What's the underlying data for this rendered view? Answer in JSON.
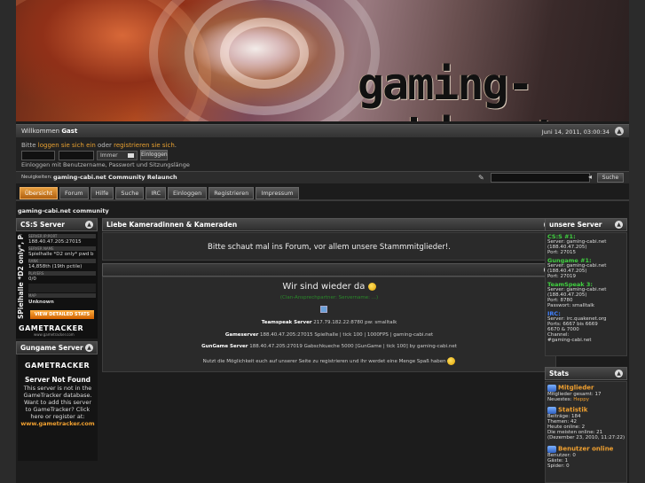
{
  "banner": {
    "logo_text": "gaming-cabi.net"
  },
  "header": {
    "greeting_prefix": "Willkommen",
    "greeting_user": "Gast",
    "datetime": "Juni 14, 2011, 03:00:34"
  },
  "login": {
    "prompt_before": "Bitte ",
    "login_link": "loggen sie sich ein",
    "prompt_mid": " oder ",
    "register_link": "registrieren sie sich",
    "prompt_after": ".",
    "remember_option": "Immer",
    "login_button": "Einloggen",
    "duration_hint": "Einloggen mit Benutzername, Passwort und Sitzungslänge"
  },
  "news": {
    "label": "Neuigkeiten:",
    "text": "gaming-cabi.net Community Relaunch",
    "search_button": "Suche"
  },
  "nav": {
    "tabs": [
      {
        "label": "Übersicht",
        "active": true
      },
      {
        "label": "Forum",
        "active": false
      },
      {
        "label": "Hilfe",
        "active": false
      },
      {
        "label": "Suche",
        "active": false
      },
      {
        "label": "IRC",
        "active": false
      },
      {
        "label": "Einloggen",
        "active": false
      },
      {
        "label": "Registrieren",
        "active": false
      },
      {
        "label": "Impressum",
        "active": false
      }
    ]
  },
  "breadcrumb": "gaming-cabi.net community",
  "left": {
    "css_title": "CS:S Server",
    "css_widget": {
      "vertical_text": "SPielhalle *D2 only*, Pu",
      "ip_header": "SERVER IP:PORT",
      "ip": "188.40.47.205:27015",
      "name_header": "SERVER NAME",
      "name": "Spielhalle *D2 only* pwd b",
      "rank_header": "RANK",
      "rank": "14,858th (19th pctile)",
      "players_header": "PLAYERS",
      "players": "0/0",
      "map_header": "MAP",
      "map": "Unknown",
      "button": "VIEW DETAILED STATS",
      "brand": "GAMETRACKER",
      "brand_url": "www.gametracker.com"
    },
    "gungame_title": "Gungame Server",
    "gungame_widget": {
      "brand": "GAMETRACKER",
      "not_found": "Server Not Found",
      "message": "This server is not in the GameTracker database. Want to add this server to GameTracker? Click here or register at:",
      "url": "www.gametracker.com"
    }
  },
  "center": {
    "panel1_title": "Liebe Kameradinnen & Kameraden",
    "panel1_text": "Bitte schaut mal ins Forum, vor allem unsere Stammmitglieder!.",
    "panel2_heading": "Wir sind wieder da",
    "panel2_sub": "(Clan-Ansprechpartner: Servername: ...)",
    "ts_label": "Teamspeak Server",
    "ts_text": "217.79.182.22:8780 pw: smalltalk",
    "gs_label": "Gameserver",
    "gs_text": "188.40.47.205:27015 Spielhalle | tick 100 | 1000FPS | gaming-cabi.net",
    "gg_label": "GunGame Server",
    "gg_text": "188.40.47.205:27019 Gabschkueche 5000 [GunGame | tick 100] by gaming-cabi.net",
    "footer_text": "Nutzt die Möglichkeit euch auf unserer Seite zu registrieren und ihr werdet eine Menge Spaß haben"
  },
  "right": {
    "irc_title": "unsere Server",
    "css_head": "CS:S #1:",
    "css_server": "Server: gaming-cabi.net",
    "css_ip": "(188.40.47.205)",
    "css_port": "Port: 27015",
    "gg_head": "Gungame #1:",
    "gg_server": "Server: gaming-cabi.net",
    "gg_ip": "(188.40.47.205)",
    "gg_port": "Port: 27019",
    "ts_head": "TeamSpeak 3:",
    "ts_server": "Server: gaming-cabi.net",
    "ts_ip": "(188.40.47.205)",
    "ts_port": "Port: 8780",
    "ts_pw": "Passwort: smalltalk",
    "irc_head": "IRC:",
    "irc_server": "Server: irc.quakenet.org",
    "irc_ports": "Ports: 6667 bis 6669",
    "irc_ports2": "6670 & 7000",
    "irc_channel": "Channel:",
    "irc_channel_name": "#gaming-cabi.net",
    "stats_title": "Stats",
    "members_title": "Mitglieder",
    "members_total": "Mitglieder gesamt: 17",
    "members_newest": "Neuestes: ",
    "members_newest_name": "Heppy",
    "statistik_title": "Statistik",
    "stat_posts": "Beiträge: 184",
    "stat_topics": "Themen: 42",
    "stat_online_today": "Heute online: 2",
    "stat_most_online": "Die meisten online: 21",
    "stat_most_online_date": "(Dezember 23, 2010, 11:27:22)",
    "online_title": "Benutzer online",
    "online_users": "Benutzer: 0",
    "online_guests": "Gäste: 1",
    "online_spiders": "Spider: 0"
  }
}
